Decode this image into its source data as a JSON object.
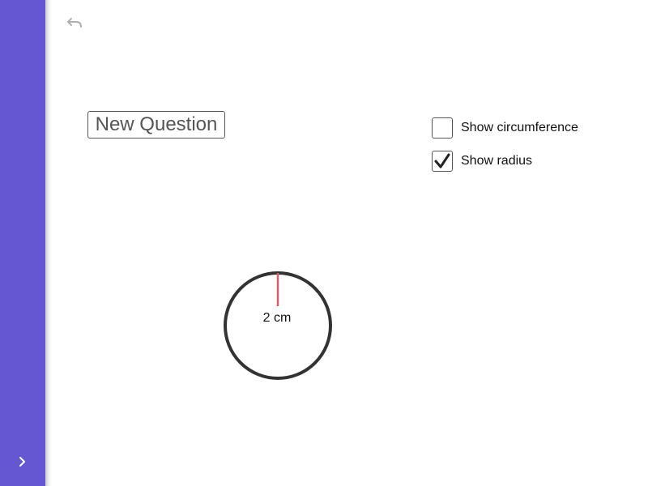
{
  "sidebar": {
    "color": "#6557d2",
    "expand_icon": "chevron-right-icon"
  },
  "toolbar": {
    "undo_icon": "undo-icon"
  },
  "new_question": {
    "label": "New Question"
  },
  "options": [
    {
      "label": "Show circumference",
      "checked": false
    },
    {
      "label": "Show radius",
      "checked": true
    }
  ],
  "diagram": {
    "radius_label": "2 cm",
    "circle_color": "#333333",
    "radius_color": "#e05a6a"
  }
}
